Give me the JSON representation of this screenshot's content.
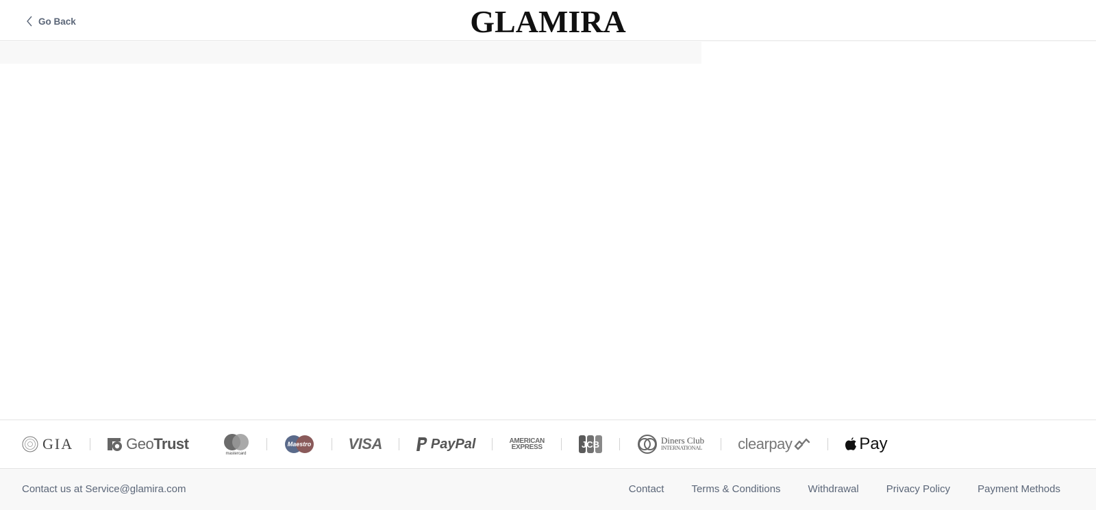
{
  "header": {
    "back_label": "Go Back",
    "logo_text": "GLAMIRA"
  },
  "trust_strip": {
    "gia": "GIA",
    "geotrust": "GeoTrust",
    "geotrust_bold": "Trust",
    "geotrust_light": "Geo",
    "mastercard_label": "mastercard",
    "maestro_label": "Maestro",
    "visa": "VISA",
    "paypal": "PayPal",
    "amex_line1": "AMERICAN",
    "amex_line2": "EXPRESS",
    "jcb": "JCB",
    "diners_line1": "Diners Club",
    "diners_line2": "INTERNATIONAL",
    "clearpay": "clearpay",
    "applepay": "Pay"
  },
  "footer": {
    "contact_text": "Contact us at Service@glamira.com",
    "links": [
      "Contact",
      "Terms & Conditions",
      "Withdrawal",
      "Privacy Policy",
      "Payment Methods"
    ]
  },
  "colors": {
    "text": "#5b6678",
    "logo": "#111111",
    "footer_bg": "#f8f8f8",
    "border": "#e3e3e3"
  }
}
